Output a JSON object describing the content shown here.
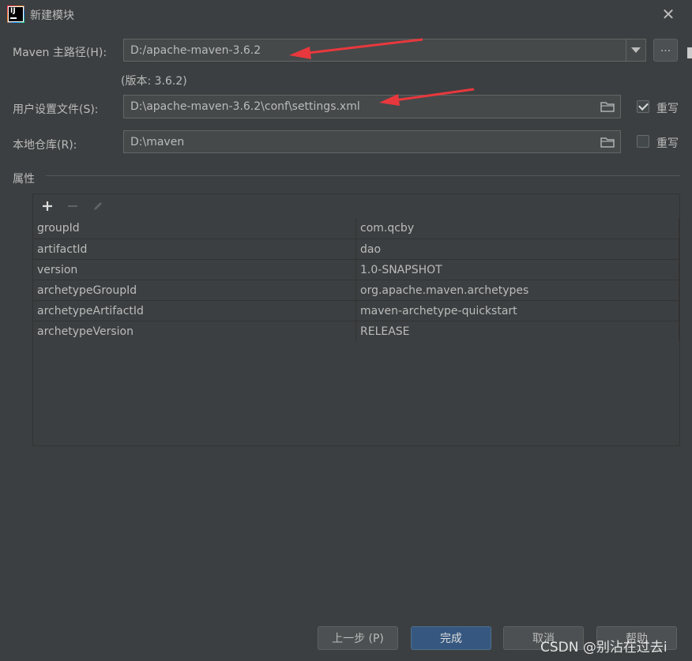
{
  "window": {
    "title": "新建模块",
    "app_icon_text": "IJ",
    "close_glyph": "✕"
  },
  "maven": {
    "home_label": "Maven 主路径(H):",
    "home_value": "D:/apache-maven-3.6.2",
    "version_text": "(版本: 3.6.2)",
    "browse_label": "...",
    "settings_label": "用户设置文件(S):",
    "settings_value": "D:\\apache-maven-3.6.2\\conf\\settings.xml",
    "settings_override_label": "重写",
    "settings_override_checked": true,
    "repo_label": "本地仓库(R):",
    "repo_value": "D:\\maven",
    "repo_override_label": "重写",
    "repo_override_checked": false
  },
  "properties": {
    "section_label": "属性",
    "toolbar": {
      "add_icon": "plus-icon",
      "remove_icon": "minus-icon",
      "edit_icon": "pencil-icon"
    },
    "rows": [
      {
        "key": "groupId",
        "value": "com.qcby"
      },
      {
        "key": "artifactId",
        "value": "dao"
      },
      {
        "key": "version",
        "value": "1.0-SNAPSHOT"
      },
      {
        "key": "archetypeGroupId",
        "value": "org.apache.maven.archetypes"
      },
      {
        "key": "archetypeArtifactId",
        "value": "maven-archetype-quickstart"
      },
      {
        "key": "archetypeVersion",
        "value": "RELEASE"
      }
    ]
  },
  "buttons": {
    "previous": "上一步 (P)",
    "finish": "完成",
    "cancel": "取消",
    "help": "帮助"
  },
  "watermark": "CSDN @别沾在过去i",
  "colors": {
    "background": "#3c3f41",
    "field": "#45494a",
    "primary_button": "#365880",
    "annotation_arrow": "#e8383d"
  }
}
